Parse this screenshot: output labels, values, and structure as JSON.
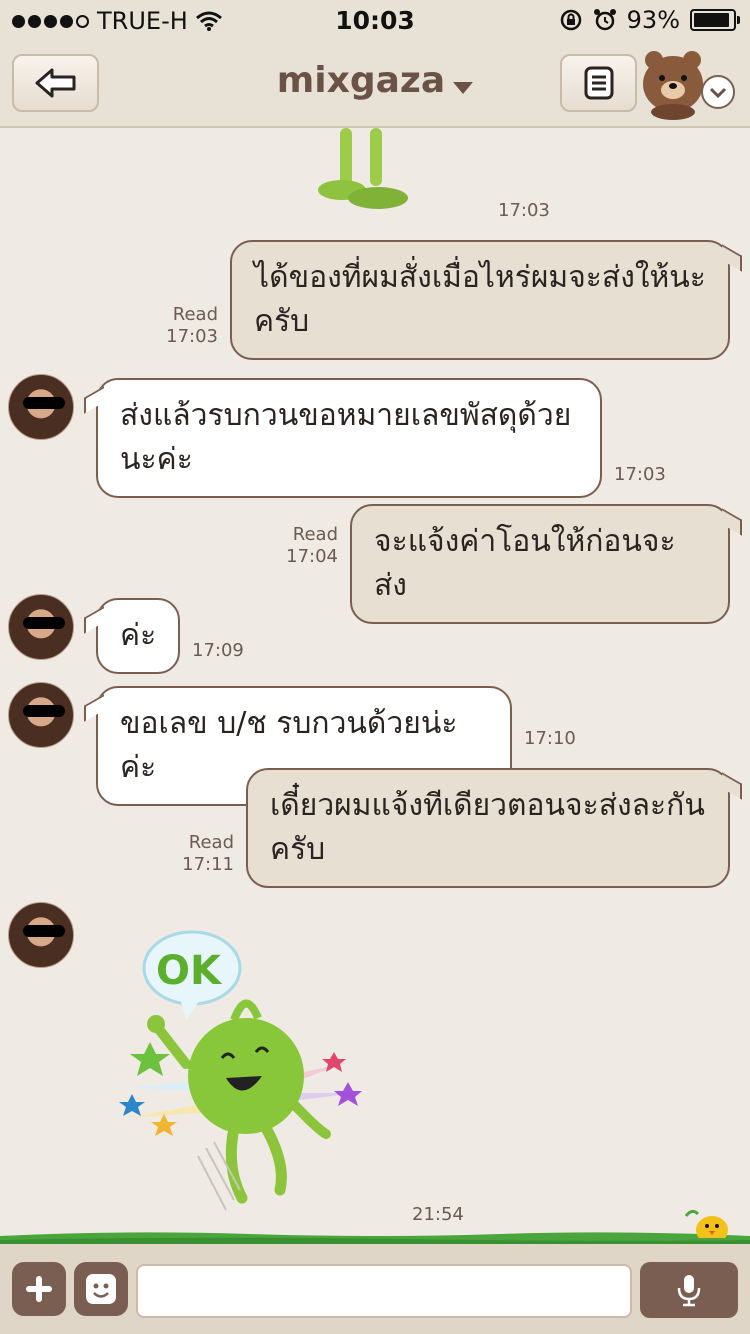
{
  "status_bar": {
    "carrier": "TRUE-H",
    "time": "10:03",
    "battery": "93%",
    "battery_level": 0.93,
    "icons": [
      "signal-dots-icon",
      "wifi-icon",
      "rotation-lock-icon",
      "alarm-icon",
      "battery-icon"
    ]
  },
  "header": {
    "title": "mixgaza",
    "back_icon": "back-arrow-icon",
    "notes_icon": "notes-icon",
    "menu_icon": "bear-avatar-chevron-icon"
  },
  "messages": [
    {
      "type": "sticker",
      "direction": "in",
      "time": "17:03"
    },
    {
      "type": "text",
      "direction": "out",
      "text_line1": "ได้ของที่ผมสั่งเมื่อไหร่ผมจะส่งให้นะ",
      "text_line2": "ครับ",
      "read": "Read",
      "time": "17:03"
    },
    {
      "type": "text",
      "direction": "in",
      "text_line1": "ส่งแล้วรบกวนขอหมายเลขพัสดุด้วย",
      "text_line2": "นะค่ะ",
      "time": "17:03"
    },
    {
      "type": "text",
      "direction": "out",
      "text_line1": "จะแจ้งค่าโอนให้ก่อนจะส่ง",
      "read": "Read",
      "time": "17:04"
    },
    {
      "type": "text",
      "direction": "in",
      "text_line1": "ค่ะ",
      "time": "17:09"
    },
    {
      "type": "text",
      "direction": "in",
      "text_line1": "ขอเลข บ/ช รบกวนด้วยน่ะค่ะ",
      "time": "17:10"
    },
    {
      "type": "text",
      "direction": "out",
      "text_line1": "เดี๋ยวผมแจ้งทีเดียวตอนจะส่งละกัน",
      "text_line2": "ครับ",
      "read": "Read",
      "time": "17:11"
    },
    {
      "type": "sticker",
      "direction": "in",
      "sticker_text": "OK",
      "time": "21:54"
    }
  ],
  "input_bar": {
    "plus_icon": "plus-icon",
    "emoji_icon": "emoji-icon",
    "mic_icon": "microphone-icon",
    "placeholder": ""
  },
  "colors": {
    "background": "#efebe4",
    "header": "#e8e1d6",
    "outgoing_bubble": "#e8dfd3",
    "incoming_bubble": "#ffffff",
    "bubble_border": "#7a5f50",
    "title": "#6b5246",
    "button_dark": "#7b5e52",
    "grass": "#4aa63c"
  }
}
